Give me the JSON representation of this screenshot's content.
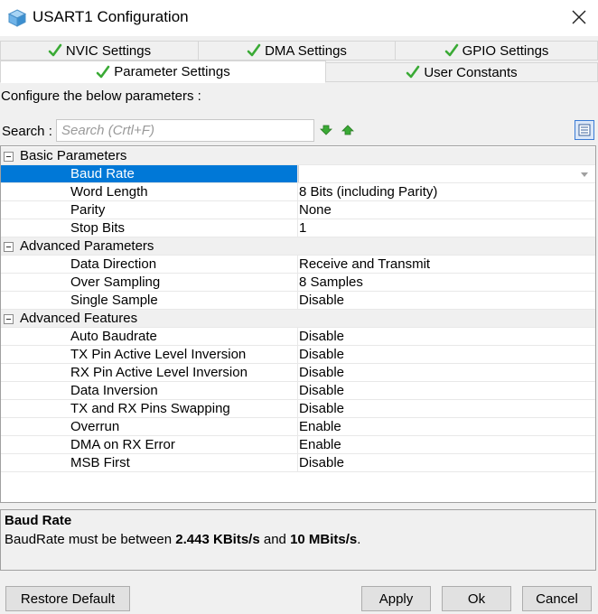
{
  "window": {
    "title": "USART1 Configuration",
    "close_icon": "close-icon",
    "app_icon": "cube-icon"
  },
  "tabs": {
    "row1": [
      {
        "label": "NVIC Settings",
        "icon": "check-icon"
      },
      {
        "label": "DMA Settings",
        "icon": "check-icon"
      },
      {
        "label": "GPIO Settings",
        "icon": "check-icon"
      }
    ],
    "row2": [
      {
        "label": "Parameter Settings",
        "icon": "check-icon",
        "active": true
      },
      {
        "label": "User Constants",
        "icon": "check-icon"
      }
    ]
  },
  "configure_text": "Configure the below parameters :",
  "search": {
    "label": "Search :",
    "placeholder": "Search (Crtl+F)"
  },
  "groups": [
    {
      "label": "Basic Parameters",
      "rows": [
        {
          "name": "Baud Rate",
          "value": "",
          "selected": true
        },
        {
          "name": "Word Length",
          "value": "8 Bits (including Parity)"
        },
        {
          "name": "Parity",
          "value": "None"
        },
        {
          "name": "Stop Bits",
          "value": "1"
        }
      ]
    },
    {
      "label": "Advanced Parameters",
      "rows": [
        {
          "name": "Data Direction",
          "value": "Receive and Transmit"
        },
        {
          "name": "Over Sampling",
          "value": "8 Samples"
        },
        {
          "name": "Single Sample",
          "value": "Disable"
        }
      ]
    },
    {
      "label": "Advanced Features",
      "rows": [
        {
          "name": "Auto Baudrate",
          "value": "Disable"
        },
        {
          "name": "TX Pin Active Level Inversion",
          "value": "Disable"
        },
        {
          "name": "RX Pin Active Level Inversion",
          "value": "Disable"
        },
        {
          "name": "Data Inversion",
          "value": "Disable"
        },
        {
          "name": "TX and RX Pins Swapping",
          "value": "Disable"
        },
        {
          "name": "Overrun",
          "value": "Enable"
        },
        {
          "name": "DMA on RX Error",
          "value": "Enable"
        },
        {
          "name": "MSB First",
          "value": "Disable"
        }
      ]
    }
  ],
  "description": {
    "title": "Baud Rate",
    "text_prefix": "BaudRate must be between ",
    "min": "2.443 KBits/s",
    "text_mid": " and ",
    "max": "10 MBits/s",
    "text_suffix": "."
  },
  "buttons": {
    "restore": "Restore Default",
    "apply": "Apply",
    "ok": "Ok",
    "cancel": "Cancel"
  },
  "colors": {
    "selection": "#0078d7",
    "check_green": "#3aaa35",
    "group_bg": "#f0f0f0"
  }
}
